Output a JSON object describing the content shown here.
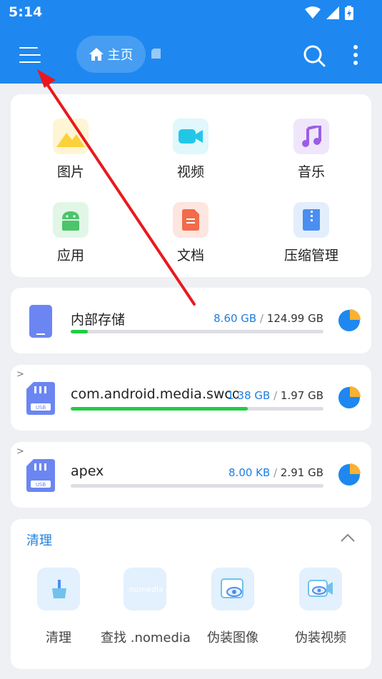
{
  "status_bar": {
    "time": "5:14"
  },
  "app_bar": {
    "home_chip_label": "主页"
  },
  "categories": [
    {
      "label": "图片",
      "icon": "image-icon",
      "color": "#fbd23b",
      "bg": "#fdf5d3"
    },
    {
      "label": "视频",
      "icon": "video-icon",
      "color": "#22c7e8",
      "bg": "#e0f7fb"
    },
    {
      "label": "音乐",
      "icon": "music-icon",
      "color": "#9b5de5",
      "bg": "#efe6fb"
    },
    {
      "label": "应用",
      "icon": "android-icon",
      "color": "#4cc46a",
      "bg": "#e2f6e7"
    },
    {
      "label": "文档",
      "icon": "document-icon",
      "color": "#f26b4a",
      "bg": "#fde6df"
    },
    {
      "label": "压缩管理",
      "icon": "archive-icon",
      "color": "#4a8ef0",
      "bg": "#e3eefd"
    }
  ],
  "storages": [
    {
      "name": "内部存储",
      "used": "8.60 GB",
      "total": "124.99 GB",
      "used_fraction": 0.069,
      "icon": "phone-icon"
    },
    {
      "name": "com.android.media.swco…",
      "used": "1.38 GB",
      "total": "1.97 GB",
      "used_fraction": 0.7,
      "icon": "usb-sd-icon"
    },
    {
      "name": "apex",
      "used": "8.00 KB",
      "total": "2.91 GB",
      "used_fraction": 0.0,
      "icon": "usb-sd-icon"
    }
  ],
  "clean": {
    "title": "清理",
    "tools": [
      {
        "label": "清理",
        "icon": "broom-icon"
      },
      {
        "label": "查找 .nomedia",
        "icon": "nomedia-icon",
        "icon_text": ".nomedia"
      },
      {
        "label": "伪装图像",
        "icon": "hidden-image-icon"
      },
      {
        "label": "伪装视频",
        "icon": "hidden-video-icon"
      }
    ]
  },
  "colors": {
    "header": "#1e88f0",
    "accent": "#1e7fe0",
    "progress": "#22cc44",
    "pie_used": "#f9b233",
    "pie_free": "#1e88f0",
    "annotation_arrow": "#e8191e"
  }
}
